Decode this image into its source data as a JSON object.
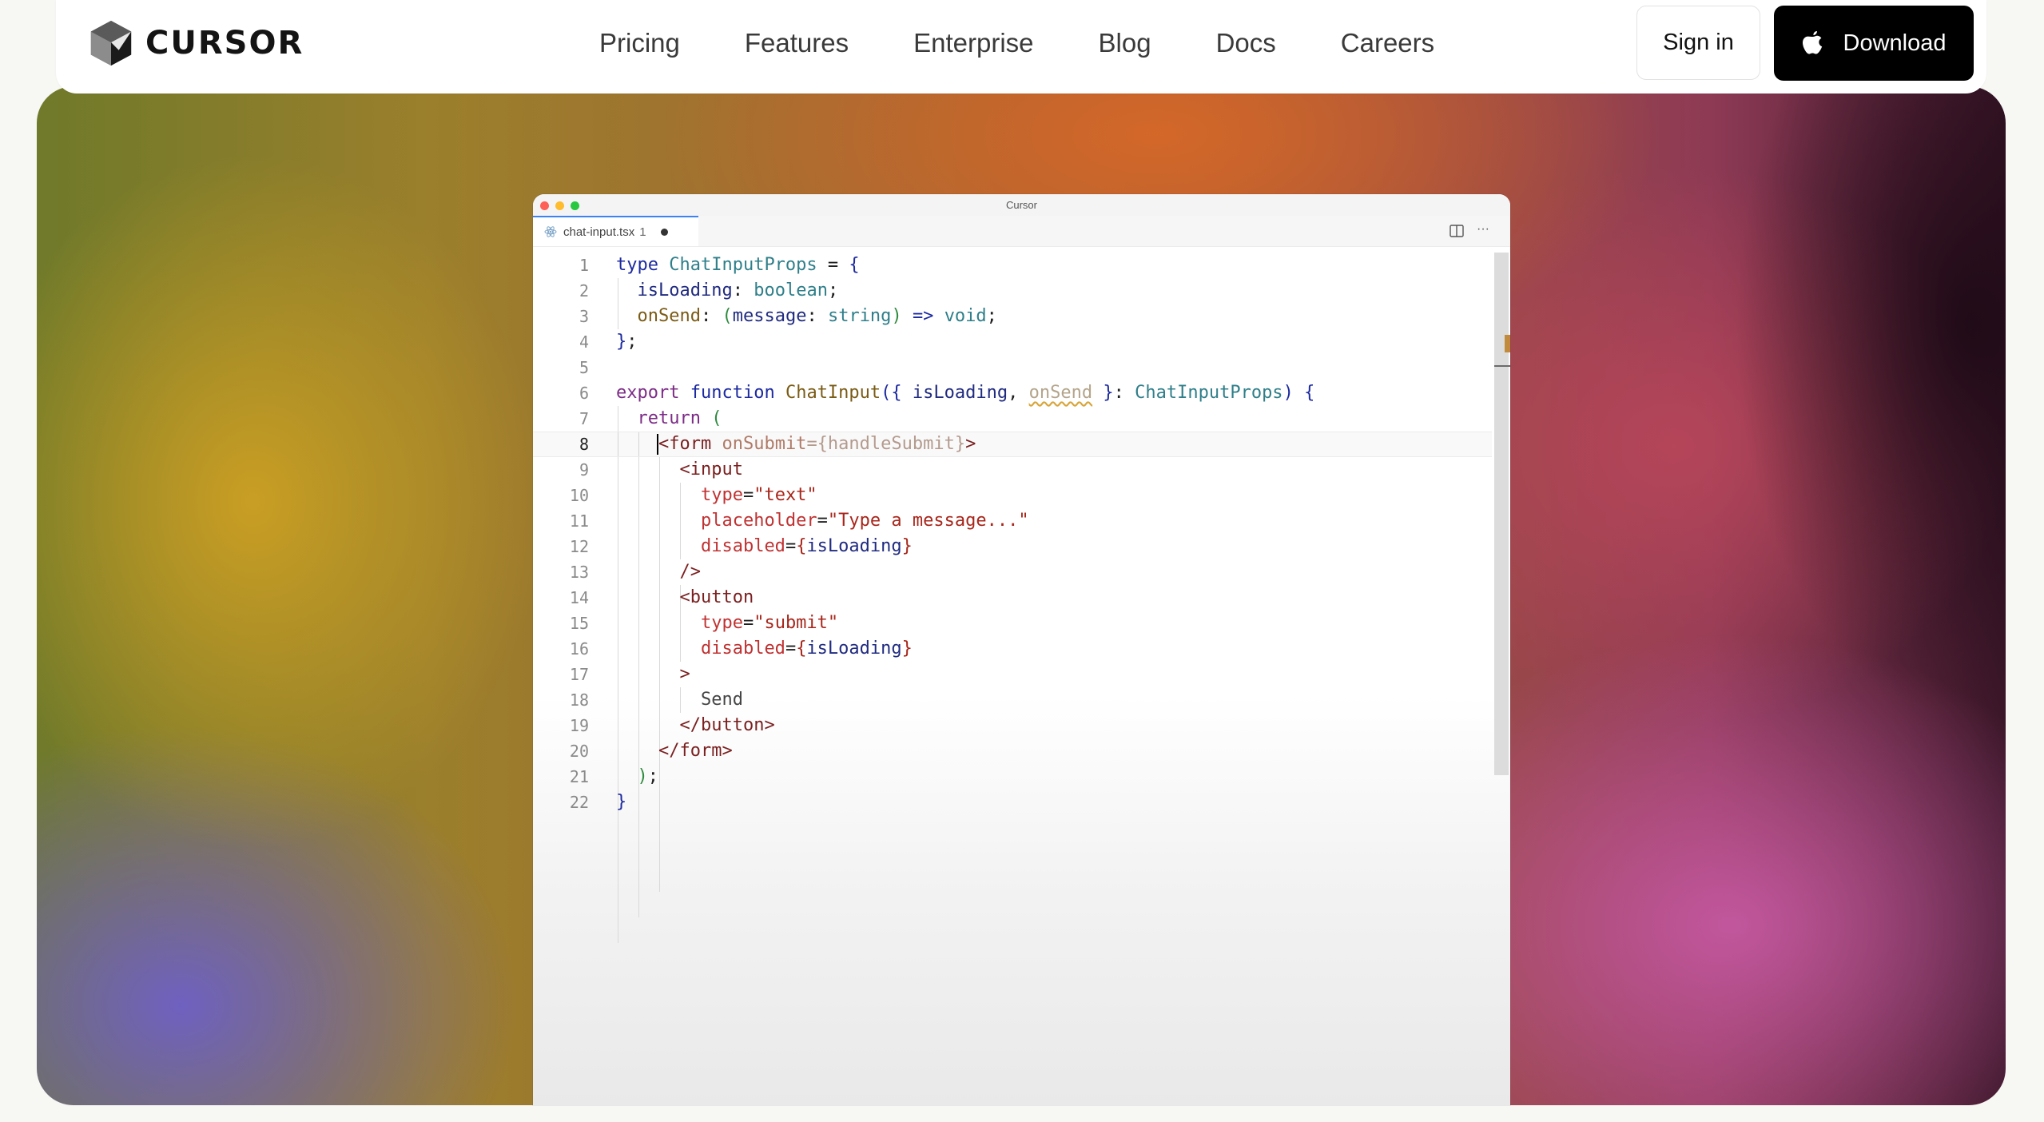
{
  "brand": {
    "name": "CURSOR"
  },
  "nav": {
    "links": [
      "Pricing",
      "Features",
      "Enterprise",
      "Blog",
      "Docs",
      "Careers"
    ],
    "sign_in": "Sign in",
    "download": "Download"
  },
  "editor": {
    "window_title": "Cursor",
    "tab": {
      "filename": "chat-input.tsx",
      "problems": "1"
    },
    "current_line": 8,
    "lines": [
      "1",
      "2",
      "3",
      "4",
      "5",
      "6",
      "7",
      "8",
      "9",
      "10",
      "11",
      "12",
      "13",
      "14",
      "15",
      "16",
      "17",
      "18",
      "19",
      "20",
      "21",
      "22"
    ]
  }
}
